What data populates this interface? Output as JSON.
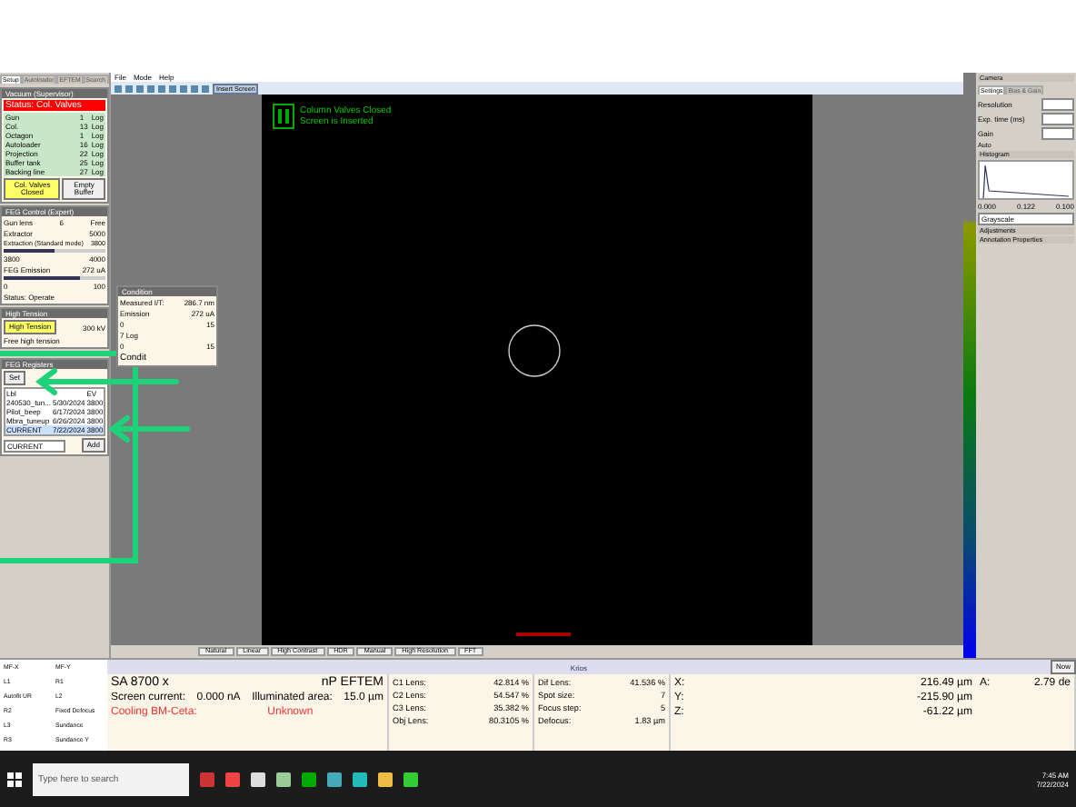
{
  "left_tabs": [
    {
      "label": "Setup",
      "selected": true
    },
    {
      "label": "Autoloader",
      "selected": false
    },
    {
      "label": "EFTEM",
      "selected": false
    },
    {
      "label": "Search",
      "selected": false
    }
  ],
  "vacuum": {
    "title": "Vacuum (Supervisor)",
    "status": "Status: Col. Valves",
    "rows": [
      {
        "label": "Gun",
        "value": "1",
        "unit": "Log"
      },
      {
        "label": "Col.",
        "value": "13",
        "unit": "Log"
      },
      {
        "label": "Octagon",
        "value": "1",
        "unit": "Log"
      },
      {
        "label": "Autoloader",
        "value": "16",
        "unit": "Log"
      },
      {
        "label": "Projection",
        "value": "22",
        "unit": "Log"
      },
      {
        "label": "Buffer tank",
        "value": "25",
        "unit": "Log"
      },
      {
        "label": "Backing line",
        "value": "27",
        "unit": "Log"
      }
    ],
    "buttons": [
      {
        "label": "Col. Valves Closed",
        "kind": "active"
      },
      {
        "label": "Empty Buffer",
        "kind": "plain"
      }
    ]
  },
  "feg": {
    "title": "FEG Control (Expert)",
    "gun_lens": "Gun lens",
    "gun_lens_value": "6",
    "free": "Free",
    "extractor": "Extractor",
    "extractor_value": "5000",
    "extraction": "Extraction (Standard mode)",
    "extraction_value": "3800",
    "extraction_min": "3800",
    "extraction_max": "4000",
    "extraction_slider": {
      "level": 0.5
    },
    "emission": "FEG Emission",
    "emission_value": "272 uA",
    "emission_min": "0",
    "emission_max": "100",
    "emission_slider": {
      "level": 0.75
    },
    "status": "Status: Operate"
  },
  "high_tension": {
    "title": "High Tension",
    "button": "High Tension",
    "value": "300 kV",
    "free": "Free high tension"
  },
  "condition": {
    "title": "Condition",
    "measured": "Measured I/T:",
    "measured_value": "286.7 nm",
    "emission": "Emission",
    "emission_value": "272 uA",
    "min": "0",
    "max": "15",
    "step": "7 Log",
    "step_min": "0",
    "step_max": "15",
    "condit": "Condit"
  },
  "registers": {
    "title": "FEG Registers",
    "set": "Set",
    "columns": [
      "Lbl",
      "",
      "EV"
    ],
    "rows": [
      {
        "cells": [
          "240530_tun...",
          "5/30/2024",
          "3800"
        ],
        "selected": false
      },
      {
        "cells": [
          "Pilot_beep",
          "6/17/2024",
          "3800"
        ],
        "selected": false
      },
      {
        "cells": [
          "Mbra_tuneup",
          "6/26/2024",
          "3800"
        ],
        "selected": false
      },
      {
        "cells": [
          "CURRENT",
          "7/22/2024",
          "3800"
        ],
        "selected": true
      }
    ],
    "name_value": "CURRENT",
    "add": "Add"
  },
  "menu": [
    "File",
    "Mode",
    "Help"
  ],
  "toolbar": {
    "insert_screen": "Insert Screen"
  },
  "image": {
    "messages": [
      "Column Valves Closed",
      "Screen is Inserted"
    ]
  },
  "contrast_buttons": [
    "Natural",
    "Linear",
    "High Contrast",
    "HDR",
    "Manual",
    "High Resolution",
    "FFT"
  ],
  "camera": {
    "title": "Camera",
    "tabs": [
      {
        "label": "Settings",
        "selected": true
      },
      {
        "label": "Bias & Gain",
        "selected": false
      }
    ],
    "fields": [
      "Resolution",
      "Exp. time (ms)",
      "Gain"
    ],
    "auto": "Auto",
    "histogram": "Histogram",
    "hist_ticks": [
      "0.000",
      "0.122",
      "0.100"
    ],
    "lut": "Grayscale",
    "sections": [
      "Adjustments",
      "Annotation Properties"
    ]
  },
  "status": {
    "title": "Krios",
    "now": "Now",
    "left_labels": [
      [
        "MF-X",
        "MF-Y"
      ],
      [
        "L1",
        "R1",
        "Autofit UR"
      ],
      [
        "L2",
        "R2",
        "Fixed Defocus"
      ],
      [
        "L3",
        "Sundance",
        "R3",
        "Sundance Y"
      ]
    ],
    "optics": [
      [
        "SA 8700 x",
        "nP EFTEM"
      ],
      [
        "Screen current:",
        "0.000 nA",
        "Illuminated area:",
        "15.0 µm"
      ]
    ],
    "cooling": "Cooling BM-Ceta:",
    "cooling_value": "Unknown",
    "lenses": [
      [
        "C1 Lens:",
        "42.814 %"
      ],
      [
        "C2 Lens:",
        "54.547 %"
      ],
      [
        "C3 Lens:",
        "35.382 %"
      ],
      [
        "Obj Lens:",
        "80.3105 %"
      ]
    ],
    "lenses2": [
      [
        "Dif Lens:",
        "41.536 %"
      ],
      [
        "Spot size:",
        "7"
      ],
      [
        "Focus step:",
        "5"
      ],
      [
        "Defocus:",
        "1.83 µm"
      ]
    ],
    "stage": [
      [
        "X:",
        "216.49 µm"
      ],
      [
        "Y:",
        "-215.90 µm"
      ],
      [
        "Z:",
        "-61.22 µm"
      ]
    ],
    "stage_a": "A:",
    "stage_a_value": "2.79 de"
  },
  "taskbar": {
    "search_placeholder": "Type here to search",
    "time": "7:45 AM",
    "date": "7/22/2024"
  }
}
